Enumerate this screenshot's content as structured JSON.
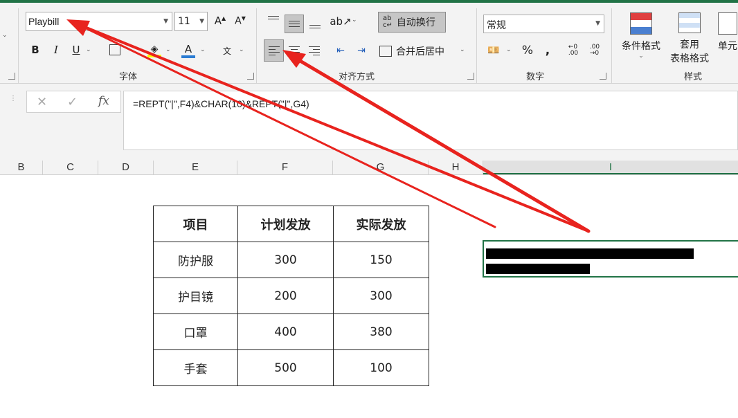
{
  "font": {
    "name": "Playbill",
    "size": "11",
    "group_label": "字体"
  },
  "alignment": {
    "wrap_text": "自动换行",
    "merge_center": "合并后居中",
    "group_label": "对齐方式"
  },
  "number": {
    "format": "常规",
    "group_label": "数字"
  },
  "styles": {
    "conditional_format": "条件格式",
    "table_format_line1": "套用",
    "table_format_line2": "表格格式",
    "cell_styles": "单元",
    "group_label": "样式"
  },
  "formula_bar": {
    "cancel_icon": "✕",
    "enter_icon": "✓",
    "fx": "fx",
    "formula": "=REPT(\"|\",F4)&CHAR(10)&REPT(\"|\",G4)"
  },
  "columns": [
    "B",
    "C",
    "D",
    "E",
    "F",
    "G",
    "H",
    "I"
  ],
  "table": {
    "headers": [
      "项目",
      "计划发放",
      "实际发放"
    ],
    "rows": [
      [
        "防护服",
        "300",
        "150"
      ],
      [
        "护目镜",
        "200",
        "300"
      ],
      [
        "口罩",
        "400",
        "380"
      ],
      [
        "手套",
        "500",
        "100"
      ]
    ]
  },
  "cell_i4": {
    "bar1_value": 300,
    "bar2_value": 150
  },
  "colors": {
    "excel_green": "#217346",
    "arrow_red": "#e8231e",
    "pressed": "#c6c6c6"
  }
}
